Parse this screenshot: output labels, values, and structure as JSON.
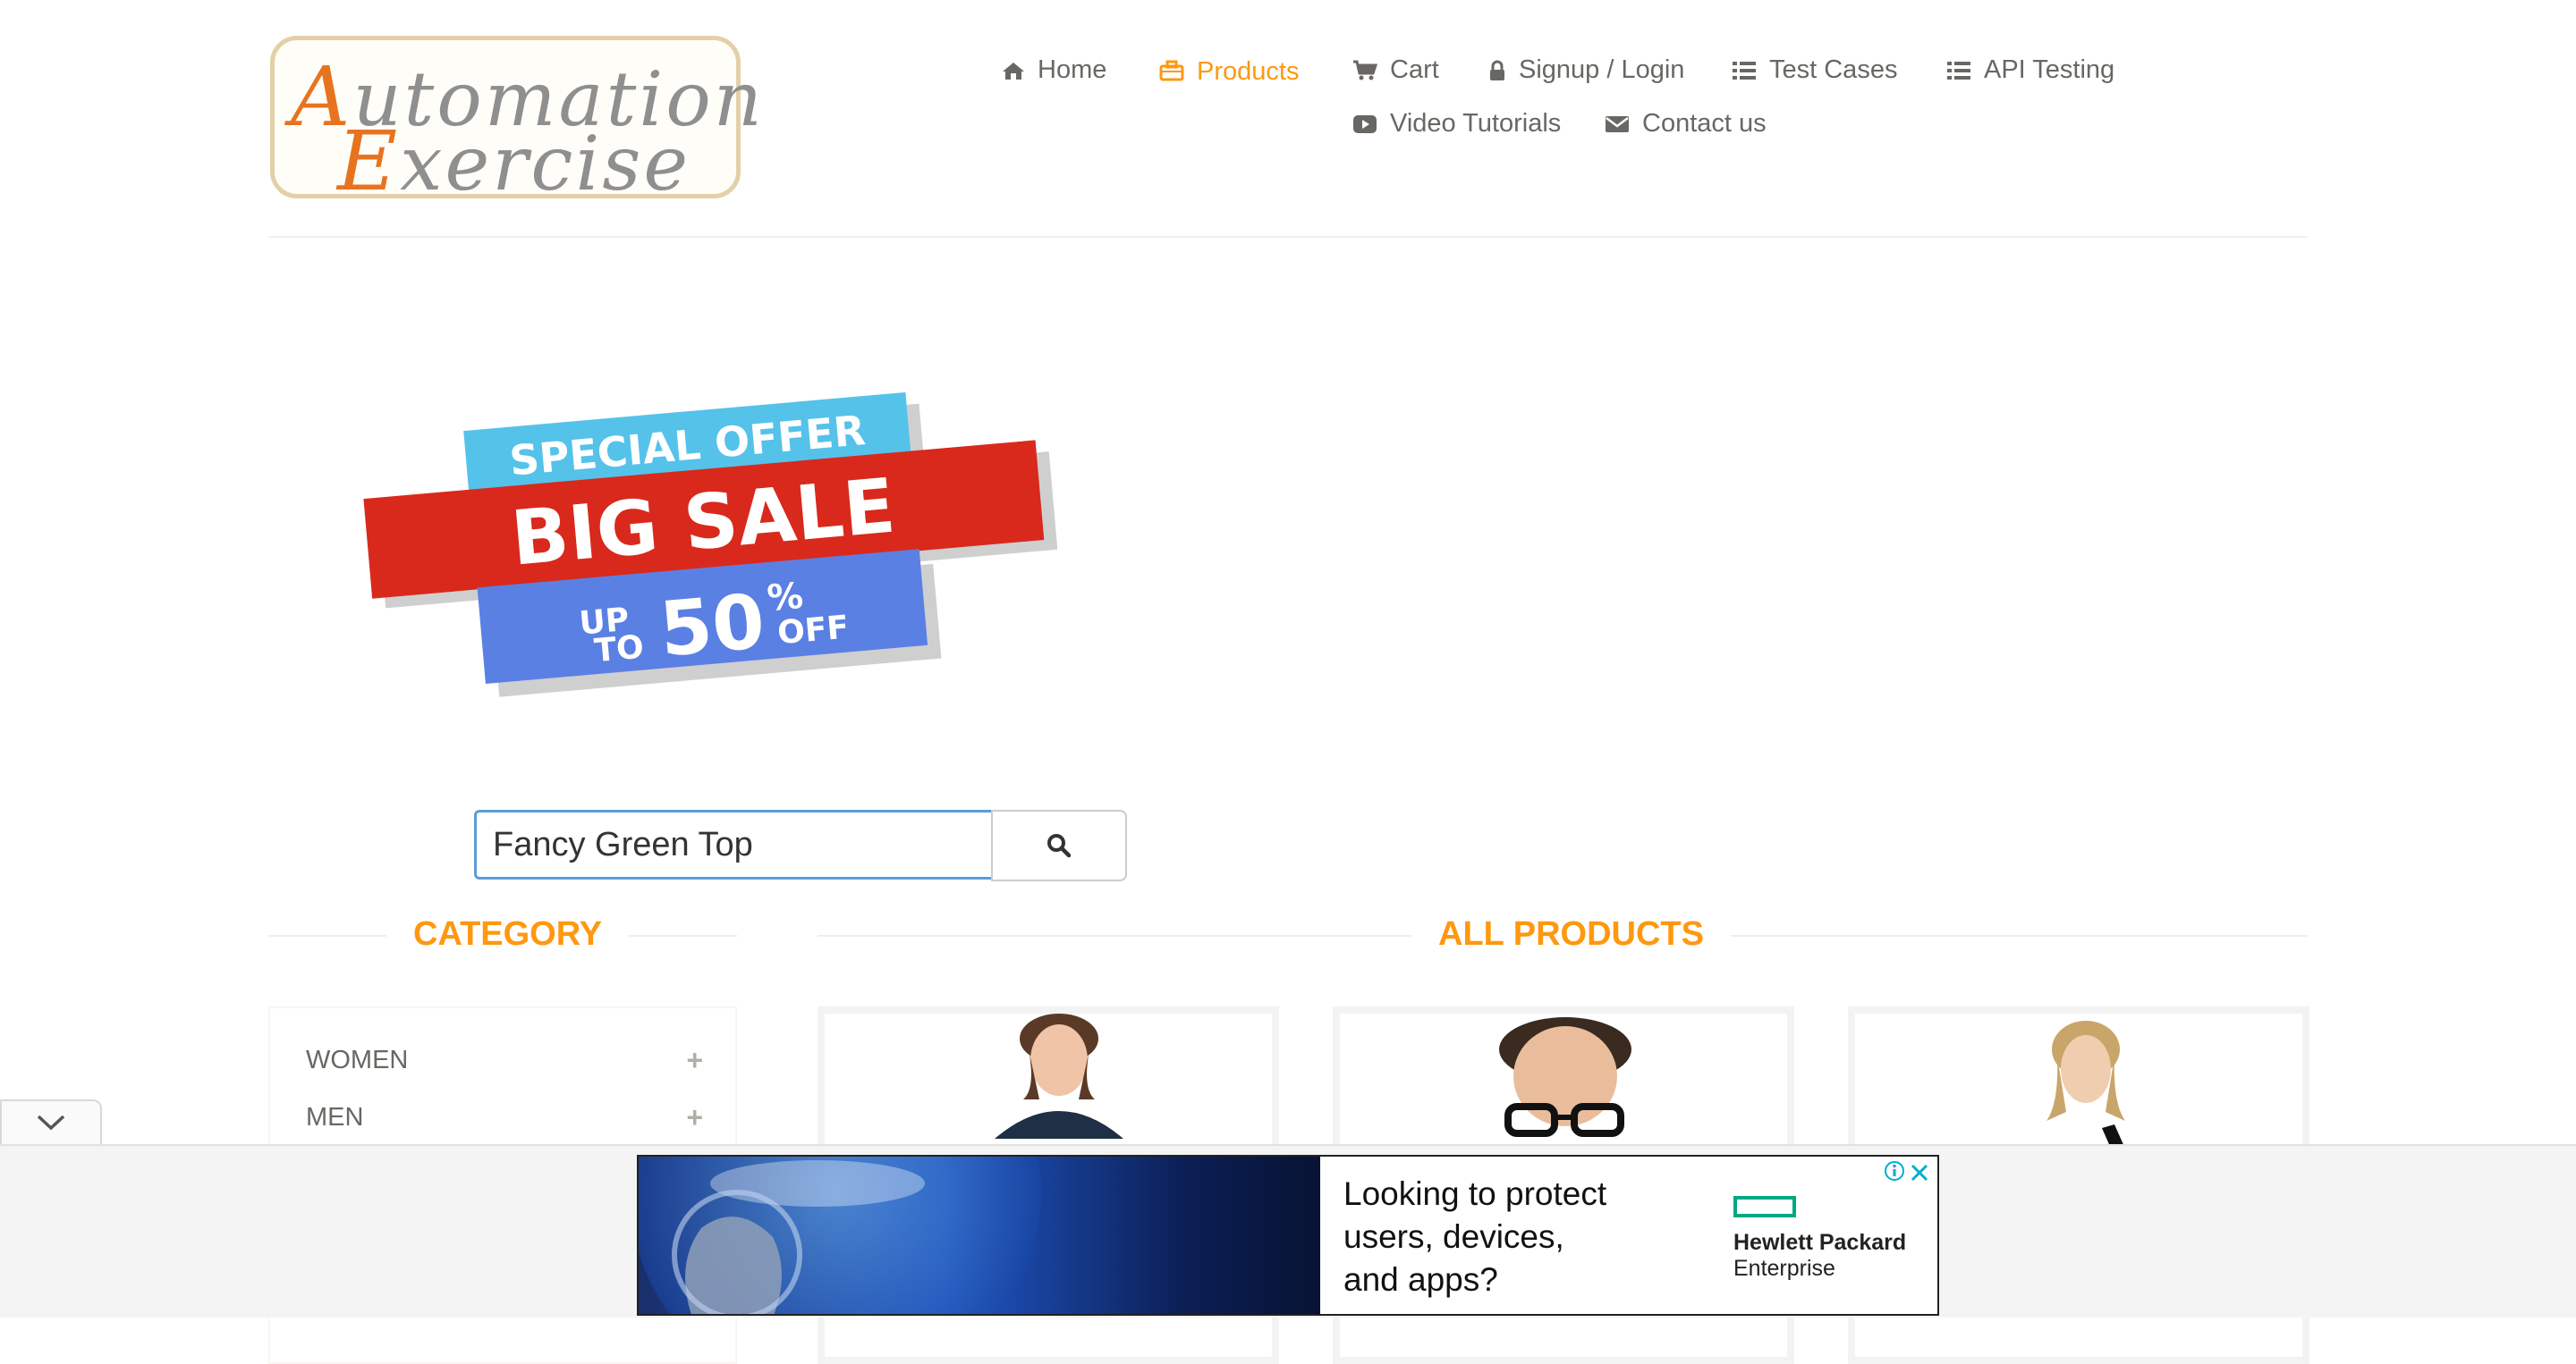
{
  "logo": {
    "line1_first": "A",
    "line1_rest": "utomation",
    "line2_first": "E",
    "line2_rest": "xercise"
  },
  "nav": {
    "home": "Home",
    "products": "Products",
    "cart": "Cart",
    "signup_login": "Signup / Login",
    "test_cases": "Test Cases",
    "api_testing": "API Testing",
    "video_tutorials": "Video Tutorials",
    "contact_us": "Contact us"
  },
  "banner": {
    "line1": "SPECIAL OFFER",
    "line2": "BIG SALE",
    "up": "UP",
    "to": "TO",
    "number": "50",
    "percent": "%",
    "off": "OFF"
  },
  "search": {
    "value": "Fancy Green Top"
  },
  "sections": {
    "category_title": "CATEGORY",
    "products_title": "ALL PRODUCTS"
  },
  "categories": [
    {
      "label": "WOMEN"
    },
    {
      "label": "MEN"
    }
  ],
  "ad": {
    "headline_lines": [
      "Looking to protect",
      "users, devices,",
      "and apps?"
    ],
    "brand_line1": "Hewlett Packard",
    "brand_line2": "Enterprise"
  },
  "colors": {
    "accent": "#fe980f",
    "text": "#696763",
    "ad_close": "#00aecd",
    "hpe_green": "#01a982"
  },
  "icons": [
    "home-icon",
    "briefcase-icon",
    "cart-icon",
    "lock-icon",
    "list-icon",
    "youtube-icon",
    "envelope-icon",
    "search-icon",
    "plus-icon",
    "chevron-down-icon",
    "info-icon",
    "close-icon"
  ]
}
